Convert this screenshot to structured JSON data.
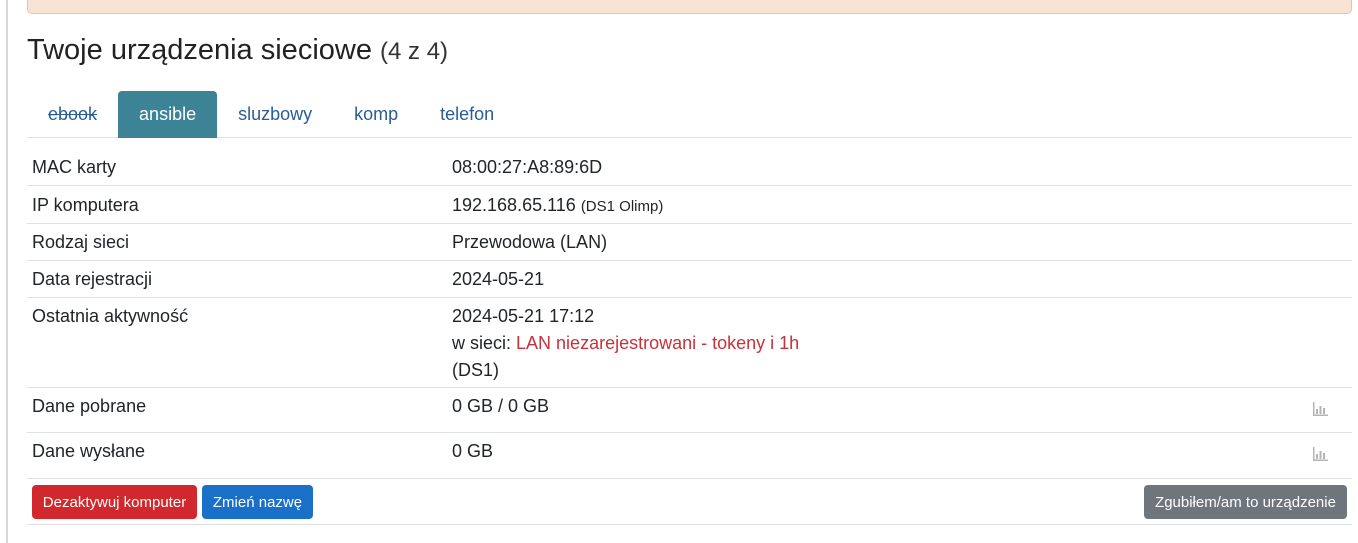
{
  "header": {
    "title": "Twoje urządzenia sieciowe",
    "count": "(4 z 4)"
  },
  "tabs": [
    {
      "label": "ebook",
      "struck": true,
      "active": false
    },
    {
      "label": "ansible",
      "struck": false,
      "active": true
    },
    {
      "label": "sluzbowy",
      "struck": false,
      "active": false
    },
    {
      "label": "komp",
      "struck": false,
      "active": false
    },
    {
      "label": "telefon",
      "struck": false,
      "active": false
    }
  ],
  "details": {
    "mac": {
      "label": "MAC karty",
      "value": "08:00:27:A8:89:6D"
    },
    "ip": {
      "label": "IP komputera",
      "value": "192.168.65.116",
      "note": "(DS1 Olimp)"
    },
    "network_type": {
      "label": "Rodzaj sieci",
      "value": "Przewodowa (LAN)"
    },
    "registration_date": {
      "label": "Data rejestracji",
      "value": "2024-05-21"
    },
    "last_activity": {
      "label": "Ostatnia aktywność",
      "datetime": "2024-05-21 17:12",
      "network_prefix": "w sieci:",
      "network_name": "LAN niezarejestrowani - tokeny i 1h",
      "location": "(DS1)"
    },
    "downloaded": {
      "label": "Dane pobrane",
      "value": "0 GB / 0 GB",
      "icon": "bar-chart-icon"
    },
    "uploaded": {
      "label": "Dane wysłane",
      "value": "0 GB",
      "icon": "bar-chart-icon"
    }
  },
  "actions": {
    "deactivate": "Dezaktywuj komputer",
    "rename": "Zmień nazwę",
    "lost": "Zgubiłem/am to urządzenie"
  },
  "colors": {
    "active_tab": "#3d8396",
    "link": "#2a5d93",
    "danger": "#d0282d",
    "primary": "#1a6fc9",
    "secondary": "#6e757c",
    "alert_bg": "#f7e3d4"
  }
}
